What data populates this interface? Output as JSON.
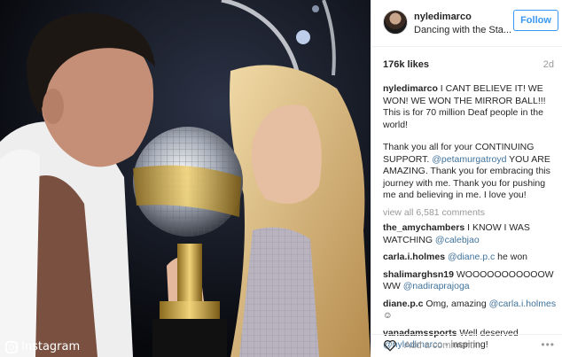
{
  "post": {
    "watermark": "Instagram",
    "username": "nyledimarco",
    "location": "Dancing with the Sta...",
    "follow_label": "Follow",
    "likes": "176k likes",
    "age": "2d"
  },
  "caption": {
    "user": "nyledimarco",
    "text1": " I CANT BELIEVE IT! WE WON! WE WON THE MIRROR BALL!!! This is for 70 million Deaf people in the world!",
    "text2a": "Thank you all for your CONTINUING SUPPORT. ",
    "mention1": "@petamurgatroyd",
    "text2b": " YOU ARE AMAZING. Thank you for embracing this journey with me. Thank you for pushing me and believing in me. I love you!"
  },
  "view_all": "view all 6,581 comments",
  "comments": [
    {
      "user": "the_amychambers",
      "text": " I KNOW I WAS WATCHING ",
      "mention": "@calebjao",
      "tail": ""
    },
    {
      "user": "carla.i.holmes",
      "text": " ",
      "mention": "@diane.p.c",
      "tail": " he won"
    },
    {
      "user": "shalimarghsn19",
      "text": " WOOOOOOOOOOOW WW ",
      "mention": "@nadiraprajoga",
      "tail": ""
    },
    {
      "user": "diane.p.c",
      "text": " Omg, amazing ",
      "mention": "@carla.i.holmes",
      "tail": " ☺"
    },
    {
      "user": "vanadamssports",
      "text": " Well deserved ",
      "mention": "@nyledimarco",
      "tail": " - inspiring!"
    }
  ],
  "footer": {
    "add_comment_placeholder": "Add a comment...",
    "more": "•••",
    "heart_icon": "heart-outline-icon"
  }
}
